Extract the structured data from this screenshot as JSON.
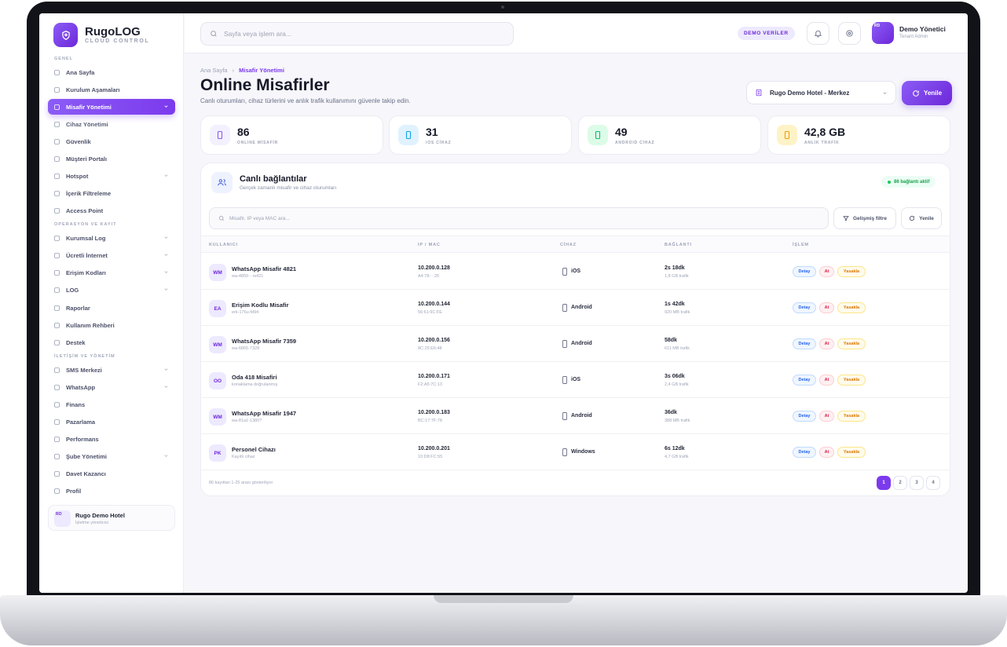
{
  "brand": {
    "name": "RugoLOG",
    "sub": "CLOUD CONTROL"
  },
  "sidebar": {
    "sections": [
      "GENEL",
      "OPERASYON VE KAYIT",
      "İLETİŞİM VE YÖNETİM"
    ],
    "items": [
      {
        "label": "Ana Sayfa",
        "icon": "grid-icon"
      },
      {
        "label": "Kurulum Aşamaları",
        "icon": "sparkle-icon"
      },
      {
        "label": "Misafir Yönetimi",
        "icon": "users-icon",
        "active": true
      },
      {
        "label": "Cihaz Yönetimi",
        "icon": "laptop-icon"
      },
      {
        "label": "Güvenlik",
        "icon": "shield-icon"
      },
      {
        "label": "Müşteri Portalı",
        "icon": "portal-icon"
      },
      {
        "label": "Hotspot",
        "icon": "wifi-icon"
      },
      {
        "label": "İçerik Filtreleme",
        "icon": "filter-icon"
      },
      {
        "label": "Access Point",
        "icon": "router-icon"
      },
      {
        "label": "Kurumsal Log",
        "icon": "info-icon"
      },
      {
        "label": "Ücretli İnternet",
        "icon": "coin-icon"
      },
      {
        "label": "Erişim Kodları",
        "icon": "card-icon"
      },
      {
        "label": "LOG",
        "icon": "log-icon"
      },
      {
        "label": "Raporlar",
        "icon": "chart-icon"
      },
      {
        "label": "Kullanım Rehberi",
        "icon": "book-icon"
      },
      {
        "label": "Destek",
        "icon": "support-icon"
      },
      {
        "label": "SMS Merkezi",
        "icon": "message-icon"
      },
      {
        "label": "WhatsApp",
        "icon": "whatsapp-icon"
      },
      {
        "label": "Finans",
        "icon": "finance-icon"
      },
      {
        "label": "Pazarlama",
        "icon": "megaphone-icon"
      },
      {
        "label": "Performans",
        "icon": "pulse-icon"
      },
      {
        "label": "Şube Yönetimi",
        "icon": "building-icon"
      },
      {
        "label": "Davet Kazancı",
        "icon": "gift-icon"
      },
      {
        "label": "Profil",
        "icon": "user-icon"
      }
    ],
    "tenant": {
      "avatar": "RO",
      "name": "Rugo Demo Hotel",
      "role": "İşletme yöneticisi"
    }
  },
  "topbar": {
    "search_placeholder": "Sayfa veya işlem ara...",
    "demo_badge": "DEMO VERİLER",
    "user_initials": "RD",
    "user_name": "Demo Yönetici",
    "user_role": "Tenant Admin"
  },
  "page": {
    "breadcrumb": [
      "Ana Sayfa",
      "›",
      "Misafir Yönetimi"
    ],
    "title": "Online Misafirler",
    "subtitle": "Canlı oturumları, cihaz türlerini ve anlık trafik kullanımını güvenle takip edin.",
    "hotel": "Rugo Demo Hotel - Merkez",
    "refresh": "Yenile"
  },
  "stats": [
    {
      "value": "86",
      "label": "ONLINE MİSAFİR",
      "color": "#8b5cf6",
      "bg": "#f3f0ff"
    },
    {
      "value": "31",
      "label": "iOS CİHAZ",
      "color": "#0ea5e9",
      "bg": "#e0f2fe"
    },
    {
      "value": "49",
      "label": "ANDROID CİHAZ",
      "color": "#10b981",
      "bg": "#dcfce7"
    },
    {
      "value": "42,8 GB",
      "label": "ANLIK TRAFİK",
      "color": "#f59e0b",
      "bg": "#fef3c7"
    }
  ],
  "panel": {
    "title": "Canlı bağlantılar",
    "subtitle": "Gerçek zamanlı misafir ve cihaz oturumları",
    "live_badge": "86 bağlantı aktif",
    "search_placeholder": "Misafir, IP veya MAC ara...",
    "filter_label": "Gelişmiş filtre",
    "refresh_label": "Yenile",
    "columns": [
      "KULLANICI",
      "IP / MAC",
      "CİHAZ",
      "BAĞLANTI",
      "İŞLEM"
    ],
    "rows": [
      {
        "initials": "WM",
        "name": "WhatsApp Misafir 4821",
        "sub": "wa-4850···rs421",
        "ip": "10.200.0.128",
        "mac": "A4:78:··:25",
        "device": "iOS",
        "duration": "2s 18dk",
        "traffic": "1,8 GB trafik"
      },
      {
        "initials": "EA",
        "name": "Erişim Kodlu Misafir",
        "sub": "erk-176u-fd94",
        "ip": "10.200.0.144",
        "mac": "56:61:9C:FE",
        "device": "Android",
        "duration": "1s 42dk",
        "traffic": "920 MB trafik"
      },
      {
        "initials": "WM",
        "name": "WhatsApp Misafir 7359",
        "sub": "wa-6865-7328",
        "ip": "10.200.0.156",
        "mac": "8C:25:E6:48",
        "device": "Android",
        "duration": "58dk",
        "traffic": "611 MB trafik"
      },
      {
        "initials": "OO",
        "name": "Oda 418 Misafiri",
        "sub": "konaklama doğrulanmış",
        "ip": "10.200.0.171",
        "mac": "F2:A5:7C:13",
        "device": "iOS",
        "duration": "3s 06dk",
        "traffic": "2,4 GB trafik"
      },
      {
        "initials": "WM",
        "name": "WhatsApp Misafir 1947",
        "sub": "wa-81a1-1380?",
        "ip": "10.200.0.183",
        "mac": "BC:17:7F:78",
        "device": "Android",
        "duration": "36dk",
        "traffic": "388 MB trafik"
      },
      {
        "initials": "PK",
        "name": "Personel Cihazı",
        "sub": "Kayıtlı cihaz",
        "ip": "10.200.0.201",
        "mac": "10:D8:FC:55",
        "device": "Windows",
        "duration": "6s 12dk",
        "traffic": "4,7 GB trafik"
      }
    ],
    "actions": {
      "detail": "Detay",
      "kick": "At",
      "ban": "Yasakla"
    },
    "footer": "86 kayıttan 1-25 arası gösteriliyor",
    "pages": [
      "1",
      "2",
      "3",
      "4"
    ]
  }
}
